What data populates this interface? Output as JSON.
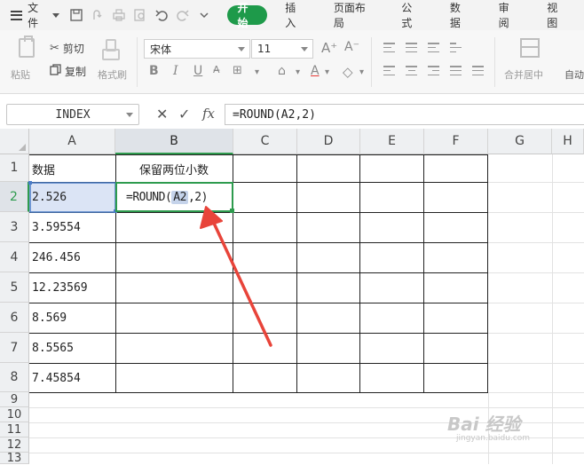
{
  "menu": {
    "file_label": "文件",
    "tabs": [
      {
        "label": "开始",
        "active": true
      },
      {
        "label": "插入",
        "active": false
      },
      {
        "label": "页面布局",
        "active": false
      },
      {
        "label": "公式",
        "active": false
      },
      {
        "label": "数据",
        "active": false
      },
      {
        "label": "审阅",
        "active": false
      },
      {
        "label": "视图",
        "active": false
      }
    ]
  },
  "ribbon": {
    "paste_label": "粘贴",
    "cut_label": "剪切",
    "copy_label": "复制",
    "format_painter_label": "格式刷",
    "font_name": "宋体",
    "font_size": "11",
    "merge_label": "合并居中",
    "auto_label": "自动"
  },
  "formula_bar": {
    "name_box": "INDEX",
    "fx_label": "fx",
    "formula": "=ROUND(A2,2)"
  },
  "columns": [
    "A",
    "B",
    "C",
    "D",
    "E",
    "F",
    "G",
    "H"
  ],
  "rows": [
    "1",
    "2",
    "3",
    "4",
    "5",
    "6",
    "7",
    "8",
    "9",
    "10",
    "11",
    "12",
    "13"
  ],
  "cells": {
    "A1": "数据",
    "B1": "保留两位小数",
    "A2": "2.526",
    "A3": "3.59554",
    "A4": "246.456",
    "A5": "12.23569",
    "A6": "8.569",
    "A7": "8.5565",
    "A8": "7.45854",
    "B2_prefix": "=ROUND(",
    "B2_ref": "A2",
    "B2_suffix": ",2)"
  },
  "selection": {
    "active_cell": "B2",
    "reference_cell": "A2",
    "accent_color": "#2e9b4e",
    "ref_color": "#4a7cc7",
    "arrow_color": "#e8443a"
  },
  "watermark": {
    "main": "Bai 经验",
    "sub": "jingyan.baidu.com"
  }
}
